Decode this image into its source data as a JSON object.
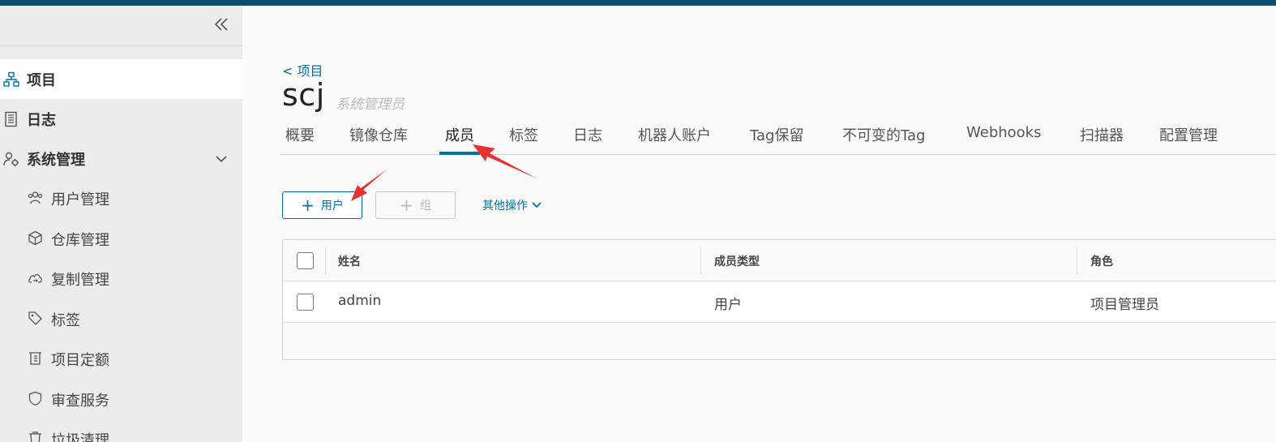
{
  "sidebar": {
    "items": [
      {
        "label": "项目",
        "icon": "project-icon"
      },
      {
        "label": "日志",
        "icon": "log-icon"
      },
      {
        "label": "系统管理",
        "icon": "system-settings-icon"
      }
    ],
    "sub_items": [
      {
        "label": "用户管理",
        "icon": "users-icon"
      },
      {
        "label": "仓库管理",
        "icon": "cube-icon"
      },
      {
        "label": "复制管理",
        "icon": "cloud-sync-icon"
      },
      {
        "label": "标签",
        "icon": "tag-icon"
      },
      {
        "label": "项目定额",
        "icon": "quota-icon"
      },
      {
        "label": "审查服务",
        "icon": "shield-icon"
      },
      {
        "label": "垃圾清理",
        "icon": "trash-icon"
      }
    ]
  },
  "header": {
    "breadcrumb": "< 项目",
    "title": "scj",
    "role": "系统管理员"
  },
  "tabs": [
    {
      "label": "概要"
    },
    {
      "label": "镜像仓库"
    },
    {
      "label": "成员"
    },
    {
      "label": "标签"
    },
    {
      "label": "日志"
    },
    {
      "label": "机器人账户"
    },
    {
      "label": "Tag保留"
    },
    {
      "label": "不可变的Tag"
    },
    {
      "label": "Webhooks"
    },
    {
      "label": "扫描器"
    },
    {
      "label": "配置管理"
    }
  ],
  "toolbar": {
    "add_user": "用户",
    "add_group": "组",
    "more_actions": "其他操作"
  },
  "table": {
    "columns": [
      "姓名",
      "成员类型",
      "角色"
    ],
    "rows": [
      {
        "name": "admin",
        "type": "用户",
        "role": "项目管理员"
      }
    ]
  },
  "colors": {
    "accent": "#0072a3",
    "topbar": "#0b4f6c",
    "annotation": "#e8322f"
  }
}
